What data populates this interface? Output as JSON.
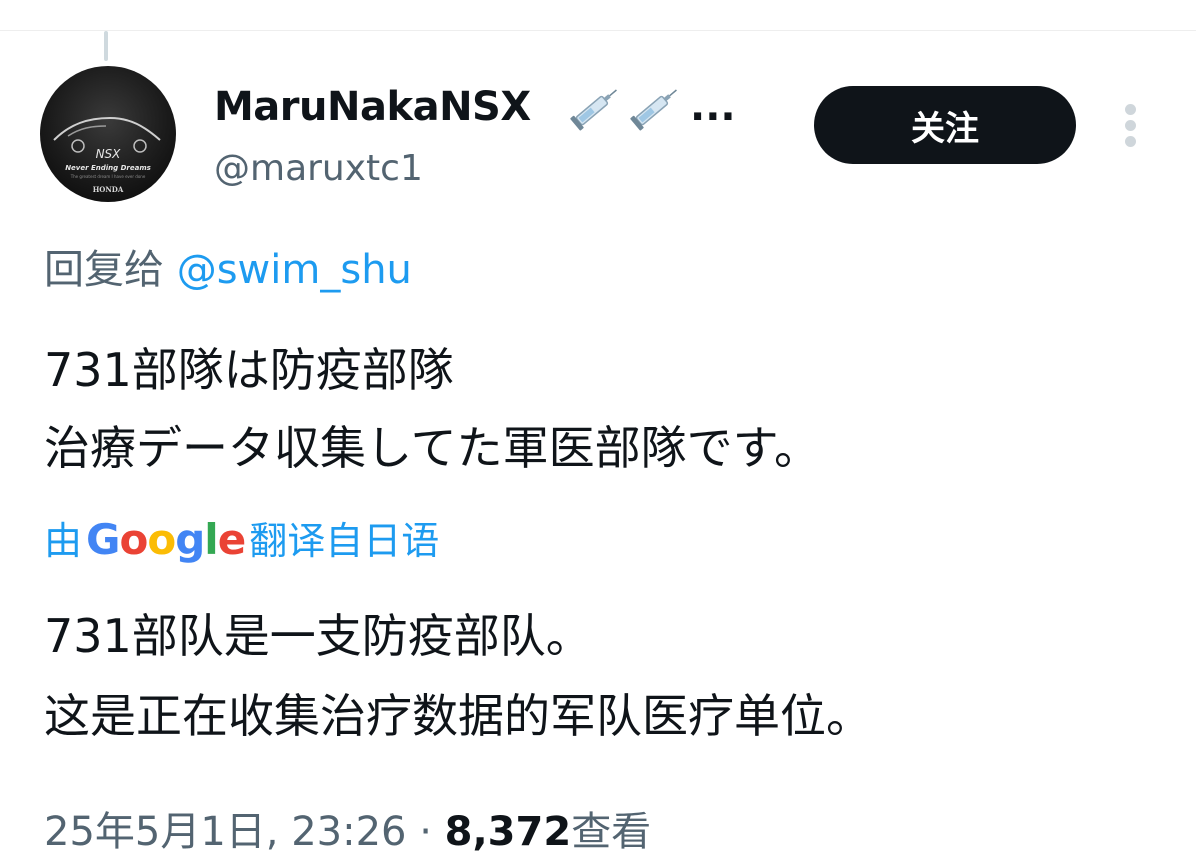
{
  "author": {
    "display_name": "MaruNakaNSX",
    "name_emoji": [
      "syringe-icon",
      "syringe-icon"
    ],
    "name_overflow": "...",
    "handle": "@maruxtc1",
    "avatar_text": {
      "logo": "NSX",
      "slogan": "Never Ending Dreams",
      "tagline": "The greatest dream I have ever done",
      "brand": "HONDA"
    }
  },
  "follow_button": {
    "label": "关注"
  },
  "more_icon": "vertical-dots-icon",
  "reply": {
    "prefix": "回复给",
    "target": "@swim_shu"
  },
  "tweet": {
    "lines": [
      "731部隊は防疫部隊",
      "治療データ収集してた軍医部隊です。"
    ]
  },
  "translation": {
    "by": "由",
    "google_letters": [
      {
        "ch": "G",
        "color": "#4285F4"
      },
      {
        "ch": "o",
        "color": "#EA4335"
      },
      {
        "ch": "o",
        "color": "#FBBC05"
      },
      {
        "ch": "g",
        "color": "#4285F4"
      },
      {
        "ch": "l",
        "color": "#34A853"
      },
      {
        "ch": "e",
        "color": "#EA4335"
      }
    ],
    "suffix": "翻译自日语",
    "lines": [
      "731部队是一支防疫部队。",
      "这是正在收集治疗数据的军队医疗单位。"
    ]
  },
  "meta": {
    "timestamp": "25年5月1日, 23:26",
    "separator": "·",
    "views_count": "8,372",
    "views_label": "查看"
  },
  "colors": {
    "accent": "#1d9bf0",
    "text": "#0f1419",
    "secondary": "#536471",
    "button_bg": "#0f1419"
  }
}
